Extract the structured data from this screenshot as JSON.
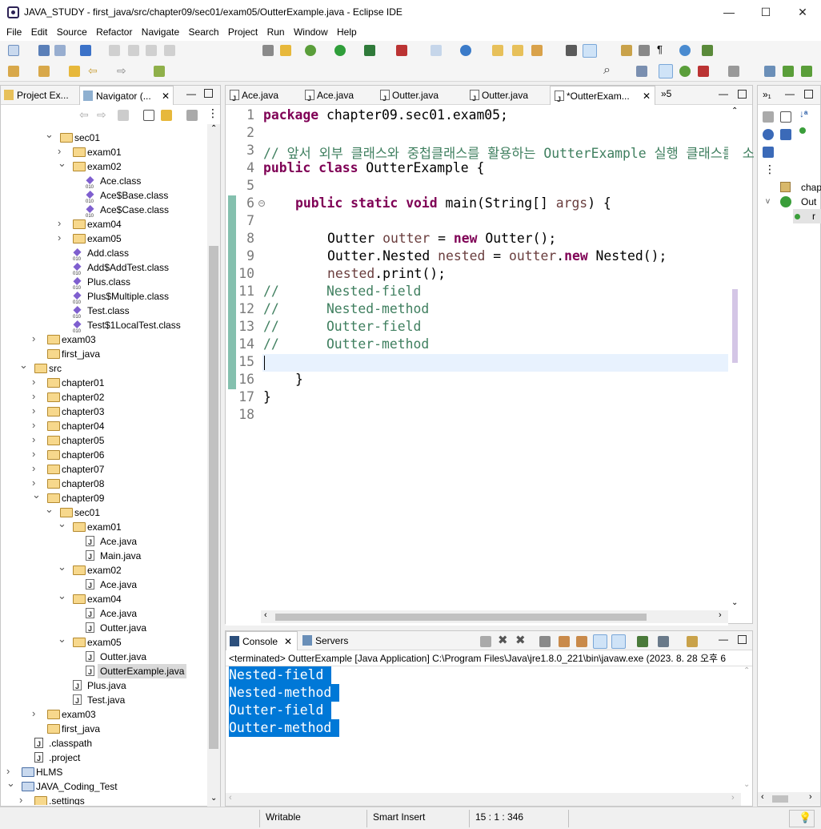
{
  "window": {
    "title": "JAVA_STUDY - first_java/src/chapter09/sec01/exam05/OutterExample.java - Eclipse IDE",
    "minimize": "—",
    "maximize": "☐",
    "close": "✕"
  },
  "menu": [
    "File",
    "Edit",
    "Source",
    "Refactor",
    "Navigate",
    "Search",
    "Project",
    "Run",
    "Window",
    "Help"
  ],
  "left_tabs": {
    "project_explorer": "Project Ex...",
    "navigator": "Navigator (..."
  },
  "tree": [
    {
      "label": "sec01",
      "indent": 3,
      "kind": "folder",
      "tw": "v"
    },
    {
      "label": "exam01",
      "indent": 4,
      "kind": "folder",
      "tw": ">"
    },
    {
      "label": "exam02",
      "indent": 4,
      "kind": "folder",
      "tw": "v"
    },
    {
      "label": "Ace.class",
      "indent": 5,
      "kind": "class",
      "tw": ""
    },
    {
      "label": "Ace$Base.class",
      "indent": 5,
      "kind": "class",
      "tw": ""
    },
    {
      "label": "Ace$Case.class",
      "indent": 5,
      "kind": "class",
      "tw": ""
    },
    {
      "label": "exam04",
      "indent": 4,
      "kind": "folder",
      "tw": ">"
    },
    {
      "label": "exam05",
      "indent": 4,
      "kind": "folder",
      "tw": ">"
    },
    {
      "label": "Add.class",
      "indent": 4,
      "kind": "class",
      "tw": ""
    },
    {
      "label": "Add$AddTest.class",
      "indent": 4,
      "kind": "class",
      "tw": ""
    },
    {
      "label": "Plus.class",
      "indent": 4,
      "kind": "class",
      "tw": ""
    },
    {
      "label": "Plus$Multiple.class",
      "indent": 4,
      "kind": "class",
      "tw": ""
    },
    {
      "label": "Test.class",
      "indent": 4,
      "kind": "class",
      "tw": ""
    },
    {
      "label": "Test$1LocalTest.class",
      "indent": 4,
      "kind": "class",
      "tw": ""
    },
    {
      "label": "exam03",
      "indent": 2,
      "kind": "folder",
      "tw": ">"
    },
    {
      "label": "first_java",
      "indent": 2,
      "kind": "folder",
      "tw": ""
    },
    {
      "label": "src",
      "indent": 1,
      "kind": "folder",
      "tw": "v"
    },
    {
      "label": "chapter01",
      "indent": 2,
      "kind": "folder",
      "tw": ">"
    },
    {
      "label": "chapter02",
      "indent": 2,
      "kind": "folder",
      "tw": ">"
    },
    {
      "label": "chapter03",
      "indent": 2,
      "kind": "folder",
      "tw": ">"
    },
    {
      "label": "chapter04",
      "indent": 2,
      "kind": "folder",
      "tw": ">"
    },
    {
      "label": "chapter05",
      "indent": 2,
      "kind": "folder",
      "tw": ">"
    },
    {
      "label": "chapter06",
      "indent": 2,
      "kind": "folder",
      "tw": ">"
    },
    {
      "label": "chapter07",
      "indent": 2,
      "kind": "folder",
      "tw": ">"
    },
    {
      "label": "chapter08",
      "indent": 2,
      "kind": "folder",
      "tw": ">"
    },
    {
      "label": "chapter09",
      "indent": 2,
      "kind": "folder",
      "tw": "v"
    },
    {
      "label": "sec01",
      "indent": 3,
      "kind": "folder",
      "tw": "v"
    },
    {
      "label": "exam01",
      "indent": 4,
      "kind": "folder",
      "tw": "v"
    },
    {
      "label": "Ace.java",
      "indent": 5,
      "kind": "java",
      "tw": ""
    },
    {
      "label": "Main.java",
      "indent": 5,
      "kind": "java",
      "tw": ""
    },
    {
      "label": "exam02",
      "indent": 4,
      "kind": "folder",
      "tw": "v"
    },
    {
      "label": "Ace.java",
      "indent": 5,
      "kind": "java",
      "tw": ""
    },
    {
      "label": "exam04",
      "indent": 4,
      "kind": "folder",
      "tw": "v"
    },
    {
      "label": "Ace.java",
      "indent": 5,
      "kind": "java",
      "tw": ""
    },
    {
      "label": "Outter.java",
      "indent": 5,
      "kind": "java",
      "tw": ""
    },
    {
      "label": "exam05",
      "indent": 4,
      "kind": "folder",
      "tw": "v"
    },
    {
      "label": "Outter.java",
      "indent": 5,
      "kind": "java",
      "tw": ""
    },
    {
      "label": "OutterExample.java",
      "indent": 5,
      "kind": "java",
      "tw": "",
      "selected": true
    },
    {
      "label": "Plus.java",
      "indent": 4,
      "kind": "java",
      "tw": ""
    },
    {
      "label": "Test.java",
      "indent": 4,
      "kind": "java",
      "tw": ""
    },
    {
      "label": "exam03",
      "indent": 2,
      "kind": "folder",
      "tw": ">"
    },
    {
      "label": "first_java",
      "indent": 2,
      "kind": "folder",
      "tw": ""
    },
    {
      "label": ".classpath",
      "indent": 1,
      "kind": "xml",
      "tw": ""
    },
    {
      "label": ".project",
      "indent": 1,
      "kind": "xml",
      "tw": ""
    },
    {
      "label": "HLMS",
      "indent": 0,
      "kind": "project",
      "tw": ">"
    },
    {
      "label": "JAVA_Coding_Test",
      "indent": 0,
      "kind": "project",
      "tw": "v"
    },
    {
      "label": ".settings",
      "indent": 1,
      "kind": "folder",
      "tw": ">"
    }
  ],
  "editor_tabs": [
    {
      "label": "Ace.java"
    },
    {
      "label": "Ace.java"
    },
    {
      "label": "Outter.java"
    },
    {
      "label": "Outter.java"
    },
    {
      "label": "*OutterExam...",
      "active": true
    }
  ],
  "editor_overflow": "»5",
  "code_lines": [
    {
      "n": "1"
    },
    {
      "n": "2"
    },
    {
      "n": "3"
    },
    {
      "n": "4"
    },
    {
      "n": "5"
    },
    {
      "n": "6"
    },
    {
      "n": "7"
    },
    {
      "n": "8"
    },
    {
      "n": "9"
    },
    {
      "n": "10"
    },
    {
      "n": "11"
    },
    {
      "n": "12"
    },
    {
      "n": "13"
    },
    {
      "n": "14"
    },
    {
      "n": "15"
    },
    {
      "n": "16"
    },
    {
      "n": "17"
    },
    {
      "n": "18"
    }
  ],
  "code": {
    "l1": [
      "package",
      " chapter09.sec01.exam05;"
    ],
    "l3": "// 앞서 외부 클래스와 중첩클래스를 활용하는 OutterExample 실행 클래스를 소",
    "l4": [
      "public",
      " ",
      "class",
      " OutterExample {"
    ],
    "l6": [
      "public",
      " ",
      "static",
      " ",
      "void",
      " main(String[] ",
      "args",
      ") {"
    ],
    "l8": [
      "Outter ",
      "outter",
      " = ",
      "new",
      " Outter();"
    ],
    "l9": [
      "Outter.Nested ",
      "nested",
      " = ",
      "outter",
      ".",
      "new",
      " Nested();"
    ],
    "l10": [
      "nested",
      ".print();"
    ],
    "l11": "//      Nested-field",
    "l12": "//      Nested-method",
    "l13": "//      Outter-field",
    "l14": "//      Outter-method",
    "l16": "}",
    "l17": "}"
  },
  "console": {
    "tab": "Console",
    "servers_tab": "Servers",
    "status": "<terminated> OutterExample [Java Application] C:\\Program Files\\Java\\jre1.8.0_221\\bin\\javaw.exe  (2023. 8. 28 오후 6",
    "output": [
      "Nested-field ",
      "Nested-method ",
      "Outter-field ",
      "Outter-method "
    ]
  },
  "outline": {
    "item1": "chap",
    "item2": "Out",
    "item3": "r"
  },
  "status": {
    "writable": "Writable",
    "insert": "Smart Insert",
    "position": "15 : 1 : 346"
  }
}
